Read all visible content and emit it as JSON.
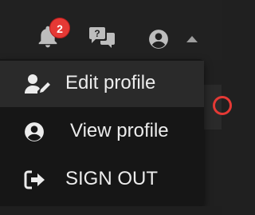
{
  "header": {
    "notifications": {
      "icon": "bell-icon",
      "count": "2"
    },
    "messages": {
      "icon": "chat-bubbles-icon"
    },
    "account": {
      "icon": "account-circle-icon"
    },
    "menu_toggle": {
      "icon": "caret-up-icon"
    }
  },
  "dropdown": {
    "items": [
      {
        "label": "Edit profile",
        "icon": "user-edit-icon"
      },
      {
        "label": "View profile",
        "icon": "user-circle-icon"
      },
      {
        "label": "SIGN OUT",
        "icon": "sign-out-icon"
      }
    ]
  },
  "colors": {
    "badge": "#e53935",
    "background": "#202020",
    "menu": "#161616",
    "menu_hover": "#2a2a2a",
    "icon": "#bdbdbd",
    "text": "#ececec"
  }
}
